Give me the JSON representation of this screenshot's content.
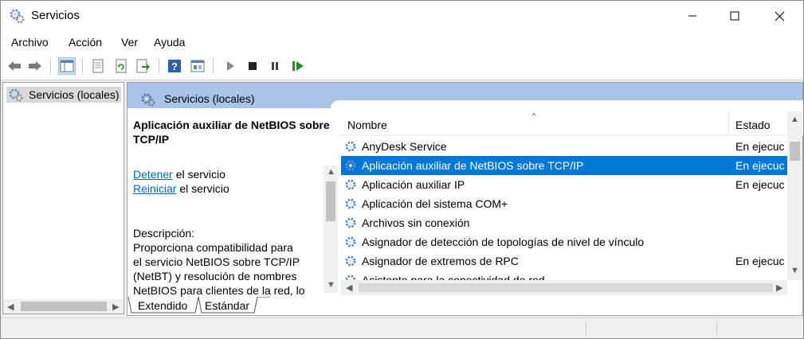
{
  "window": {
    "title": "Servicios"
  },
  "menu": [
    "Archivo",
    "Acción",
    "Ver",
    "Ayuda"
  ],
  "toolbar": {
    "icons": [
      "back-arrow-icon",
      "forward-arrow-icon",
      "show-tree-icon",
      "properties-icon",
      "refresh-icon",
      "export-icon",
      "help-icon",
      "console-icon",
      "play-icon",
      "stop-icon",
      "pause-icon",
      "restart-icon"
    ]
  },
  "tree": {
    "root_label": "Servicios (locales)"
  },
  "panel": {
    "header": "Servicios (locales)",
    "selected_title": "Aplicación auxiliar de NetBIOS sobre TCP/IP",
    "actions": [
      {
        "link": "Detener",
        "text": " el servicio"
      },
      {
        "link": "Reiniciar",
        "text": " el servicio"
      }
    ],
    "description_label": "Descripción:",
    "description_lines": [
      "Proporciona compatibilidad para",
      "el servicio NetBIOS sobre TCP/IP",
      "(NetBT) y resolución de nombres",
      "NetBIOS para clientes de la red, lo"
    ]
  },
  "list": {
    "columns": {
      "name": "Nombre",
      "state": "Estado"
    },
    "rows": [
      {
        "name": "AnyDesk Service",
        "state": "En ejecuc"
      },
      {
        "name": "Aplicación auxiliar de NetBIOS sobre TCP/IP",
        "state": "En ejecuc",
        "selected": true
      },
      {
        "name": "Aplicación auxiliar IP",
        "state": "En ejecuc"
      },
      {
        "name": "Aplicación del sistema COM+",
        "state": ""
      },
      {
        "name": "Archivos sin conexión",
        "state": ""
      },
      {
        "name": "Asignador de detección de topologías de nivel de vínculo",
        "state": ""
      },
      {
        "name": "Asignador de extremos de RPC",
        "state": "En ejecuc"
      },
      {
        "name": "Asistente para la conectividad de red",
        "state": ""
      }
    ]
  },
  "tabs": [
    "Extendido",
    "Estándar"
  ],
  "colors": {
    "selection": "#0078d7",
    "header": "#a8c4e6",
    "link": "#0066cc"
  }
}
